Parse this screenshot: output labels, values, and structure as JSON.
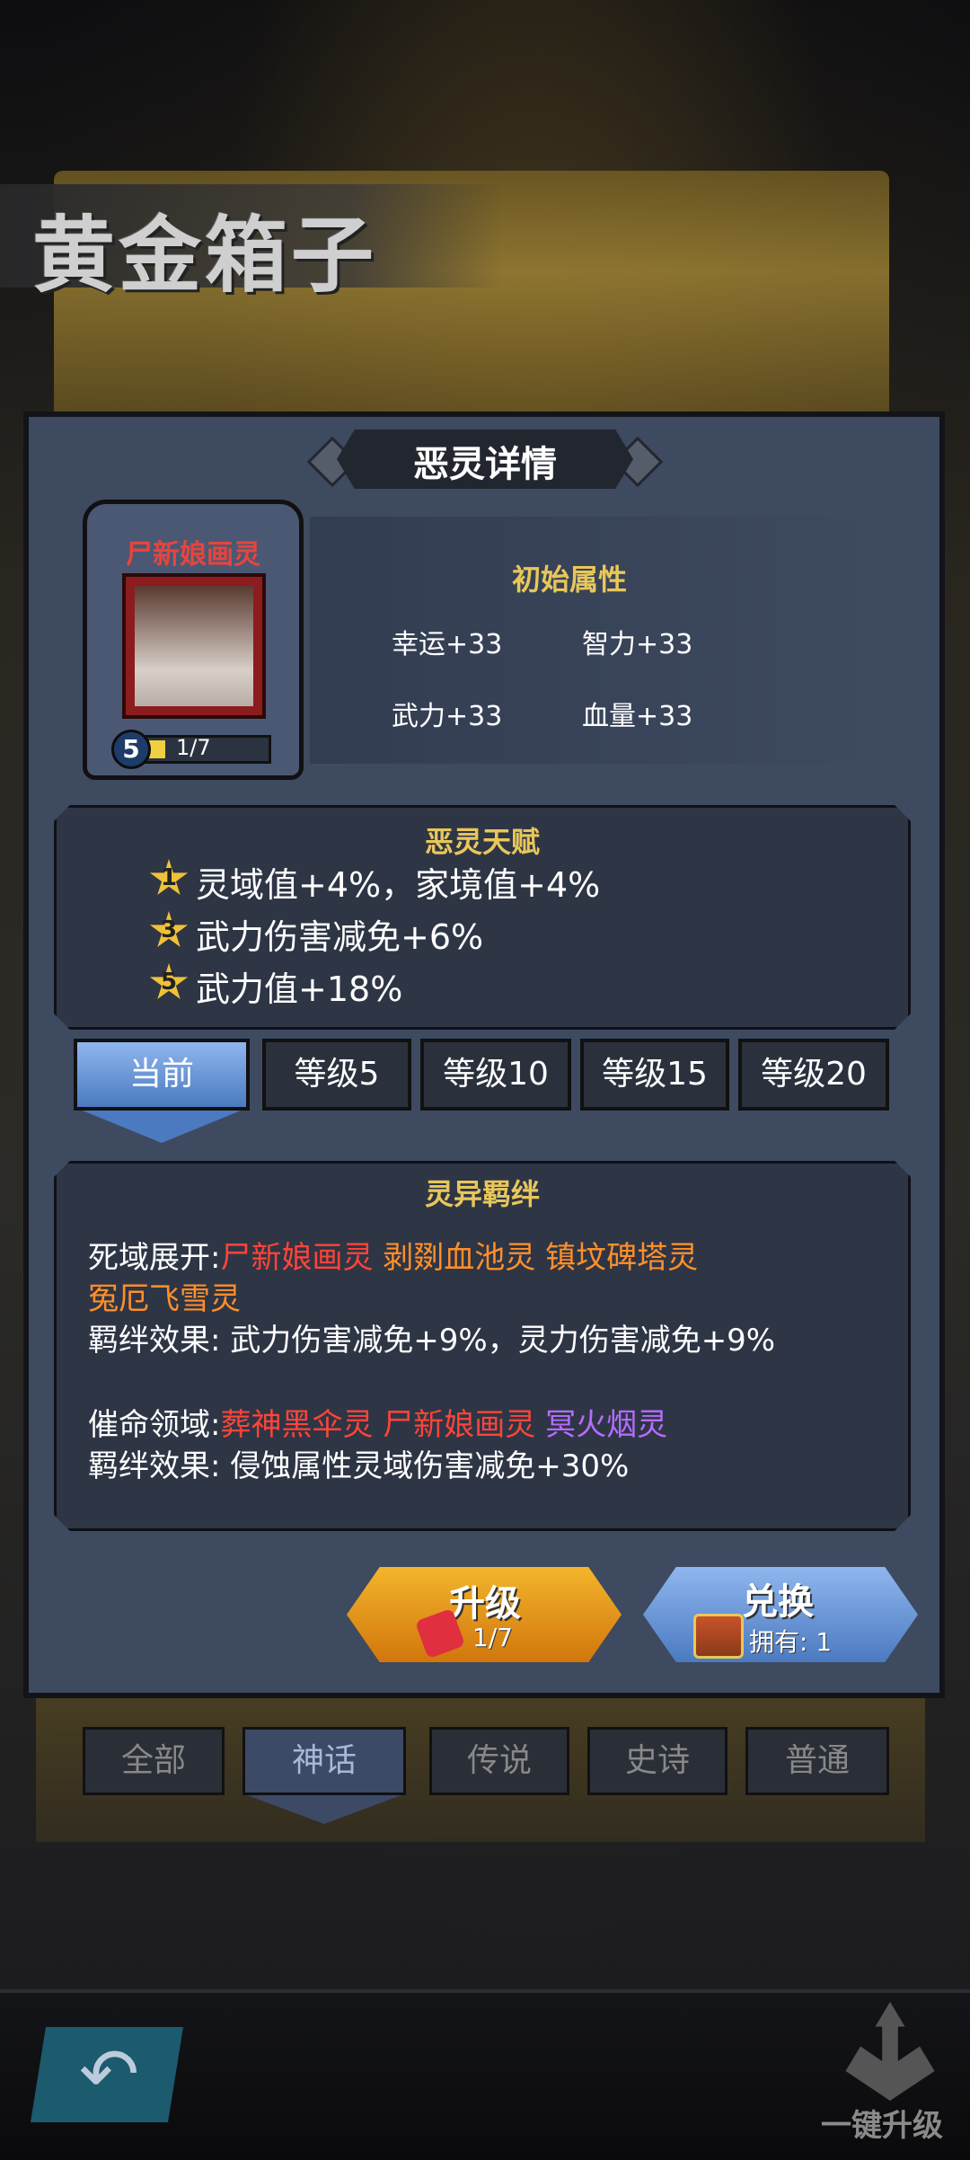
{
  "header": {
    "title": "黄金箱子"
  },
  "panel": {
    "title": "恶灵详情",
    "spirit": {
      "name": "尸新娘画灵",
      "level": "5",
      "progress_text": "1/7",
      "progress": 0.14
    },
    "attributes": {
      "title": "初始属性",
      "items": [
        "幸运+33",
        "智力+33",
        "武力+33",
        "血量+33"
      ]
    },
    "talent": {
      "title": "恶灵天赋",
      "items": [
        {
          "star": "1",
          "text": "灵域值+4%，家境值+4%"
        },
        {
          "star": "3",
          "text": "武力伤害减免+6%"
        },
        {
          "star": "5",
          "text": "武力值+18%"
        }
      ]
    },
    "level_tabs": [
      "当前",
      "等级5",
      "等级10",
      "等级15",
      "等级20"
    ],
    "bond": {
      "title": "灵异羁绊",
      "groups": [
        {
          "name": "死域展开:",
          "members": [
            "尸新娘画灵",
            "剥剟血池灵",
            "镇坟碑塔灵",
            "冤厄飞雪灵"
          ],
          "effect": "羁绊效果: 武力伤害减免+9%，灵力伤害减免+9%"
        },
        {
          "name": "催命领域:",
          "members": [
            "葬神黑伞灵",
            "尸新娘画灵",
            "冥火烟灵"
          ],
          "effect": "羁绊效果: 侵蚀属性灵域伤害减免+30%"
        }
      ]
    },
    "upgrade_button": {
      "label": "升级",
      "count": "1/7"
    },
    "exchange_button": {
      "label": "兑换",
      "owned": "拥有: 1"
    }
  },
  "category_tabs": [
    "全部",
    "神话",
    "传说",
    "史诗",
    "普通"
  ],
  "footer": {
    "upgrade_all": "一键升级"
  },
  "colors": {
    "gold": "#e8c75a",
    "red": "#ff4438",
    "orange": "#ff8f2a",
    "purple": "#b66cff",
    "panel": "#3e4a60"
  },
  "icons": [
    "star-icon",
    "puzzle-icon",
    "chest-icon",
    "back-arrow-icon",
    "upgrade-all-icon"
  ]
}
